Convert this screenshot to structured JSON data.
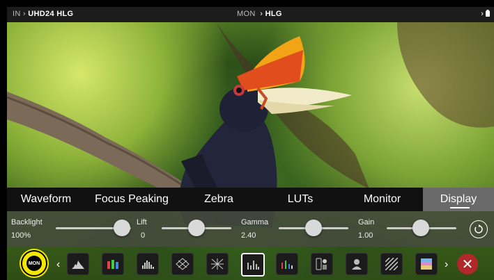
{
  "status_bar": {
    "input_label": "IN",
    "input_arrow": "›",
    "input_value": "UHD24 HLG",
    "monitor_label": "MON",
    "monitor_arrow": "›",
    "monitor_value": "HLG",
    "right_arrow": "›"
  },
  "tabs": [
    {
      "label": "Waveform"
    },
    {
      "label": "Focus Peaking"
    },
    {
      "label": "Zebra"
    },
    {
      "label": "LUTs"
    },
    {
      "label": "Monitor"
    },
    {
      "label": "Display"
    }
  ],
  "active_tab": "Display",
  "controls": {
    "backlight": {
      "label": "Backlight",
      "value": "100%",
      "level": 1.0
    },
    "lift": {
      "label": "Lift",
      "value": "0",
      "level": 0.5
    },
    "gamma": {
      "label": "Gamma",
      "value": "2.40",
      "level": 0.5
    },
    "gain": {
      "label": "Gain",
      "value": "1.00",
      "level": 0.5
    }
  },
  "dock": {
    "mon_button": "MON",
    "prev_arrow": "‹",
    "next_arrow": "›",
    "tools": [
      "histogram-icon",
      "rgb-parade-icon",
      "waveform-icon",
      "vectorscope-icon",
      "cross-vector-icon",
      "luma-bars-icon",
      "rgb-bars-icon",
      "false-color-icon",
      "skin-tone-icon",
      "zebra-pattern-icon",
      "lut-icon"
    ],
    "selected_tool": "luma-bars-icon",
    "close_symbol": "✕"
  },
  "colors": {
    "accent": "#f3e600",
    "close": "#b0282a",
    "tab_active": "#6a6a6a"
  }
}
